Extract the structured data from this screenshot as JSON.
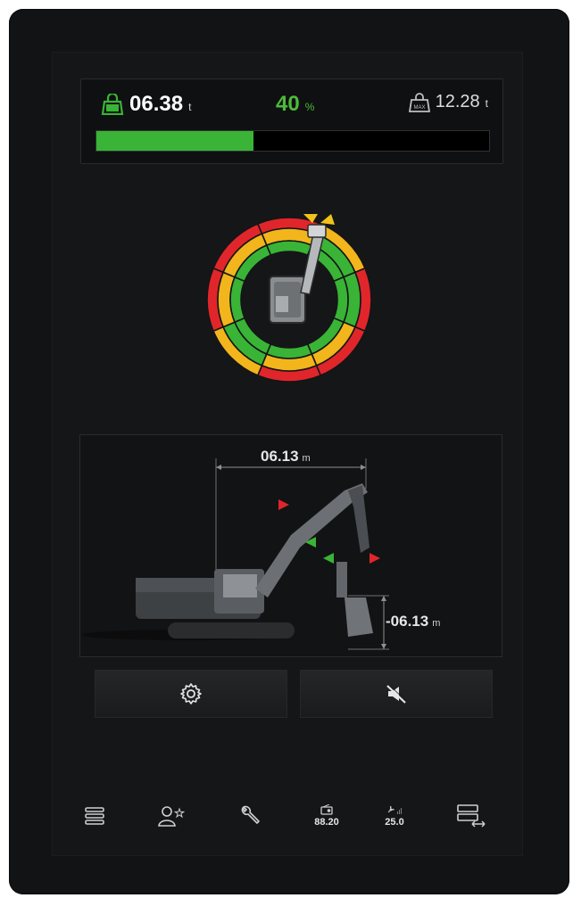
{
  "load": {
    "current_value": "06.38",
    "current_unit": "t",
    "percent_value": "40",
    "percent_unit": "%",
    "max_value": "12.28",
    "max_unit": "t",
    "progress_fraction": 0.4,
    "max_icon_text": "MAX"
  },
  "dimensions": {
    "reach_value": "06.13",
    "reach_unit": "m",
    "depth_value": "-06.13",
    "depth_unit": "m"
  },
  "colors": {
    "accent_green": "#39b436",
    "warning_yellow": "#f2b51b",
    "danger_red": "#e0262b"
  },
  "buttons": {
    "settings_icon": "gear-icon",
    "mute_icon": "mute-alarm-icon"
  },
  "bottom_bar": {
    "menu_icon": "menu-icon",
    "user_icon": "user-favorite-icon",
    "wrench_icon": "wrench-icon",
    "radio_value": "88.20",
    "fan_value": "25.0",
    "screen_switch_icon": "screen-switch-icon"
  }
}
